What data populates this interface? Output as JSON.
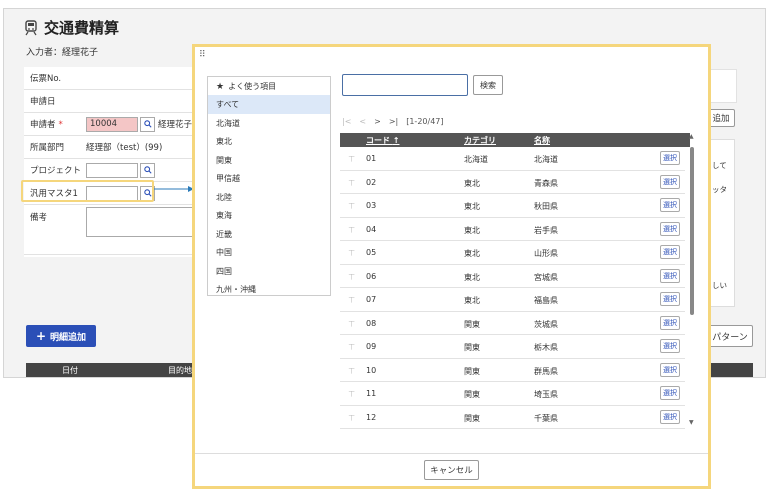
{
  "page": {
    "title": "交通費精算",
    "inputter": "入力者：経理花子"
  },
  "form": {
    "slip_no_label": "伝票No.",
    "apply_date_label": "申請日",
    "applicant_label": "申請者",
    "required_mark": "*",
    "applicant_code": "10004",
    "applicant_name": "経理花子",
    "department_label": "所属部門",
    "department_value": "経理部（test）(99)",
    "project_label": "プロジェクト",
    "general_master_label": "汎用マスタ1",
    "notes_label": "備考"
  },
  "background": {
    "add_detail_label": "明細追加",
    "col_date": "日付",
    "col_destination": "目的地",
    "right_add_label": "追加",
    "right_pattern_label": "パターン",
    "right_card_lines": [
      "して",
      "ッタ",
      "しい"
    ]
  },
  "modal": {
    "drag_handle": "⠿",
    "categories": [
      {
        "label": "よく使う項目",
        "icon": "star-icon"
      },
      {
        "label": "すべて"
      },
      {
        "label": "北海道"
      },
      {
        "label": "東北"
      },
      {
        "label": "関東"
      },
      {
        "label": "甲信越"
      },
      {
        "label": "北陸"
      },
      {
        "label": "東海"
      },
      {
        "label": "近畿"
      },
      {
        "label": "中国"
      },
      {
        "label": "四国"
      },
      {
        "label": "九州・沖縄"
      }
    ],
    "search_value": "",
    "search_button": "検索",
    "pager": {
      "first": "|<",
      "prev": "<",
      "next": ">",
      "last": ">|",
      "range": "[1-20/47]"
    },
    "columns": {
      "code": "コード",
      "category": "カテゴリ",
      "name": "名称"
    },
    "rows": [
      {
        "code": "01",
        "category": "北海道",
        "name": "北海道"
      },
      {
        "code": "02",
        "category": "東北",
        "name": "青森県"
      },
      {
        "code": "03",
        "category": "東北",
        "name": "秋田県"
      },
      {
        "code": "04",
        "category": "東北",
        "name": "岩手県"
      },
      {
        "code": "05",
        "category": "東北",
        "name": "山形県"
      },
      {
        "code": "06",
        "category": "東北",
        "name": "宮城県"
      },
      {
        "code": "07",
        "category": "東北",
        "name": "福島県"
      },
      {
        "code": "08",
        "category": "関東",
        "name": "茨城県"
      },
      {
        "code": "09",
        "category": "関東",
        "name": "栃木県"
      },
      {
        "code": "10",
        "category": "関東",
        "name": "群馬県"
      },
      {
        "code": "11",
        "category": "関東",
        "name": "埼玉県"
      },
      {
        "code": "12",
        "category": "関東",
        "name": "千葉県"
      }
    ],
    "select_label": "選択",
    "cancel_label": "キャンセル"
  },
  "colors": {
    "highlight": "#f5d67c",
    "primary": "#2b4fb7",
    "selected_category": "#dce8f8",
    "applicant_field": "#f4c6c6"
  }
}
